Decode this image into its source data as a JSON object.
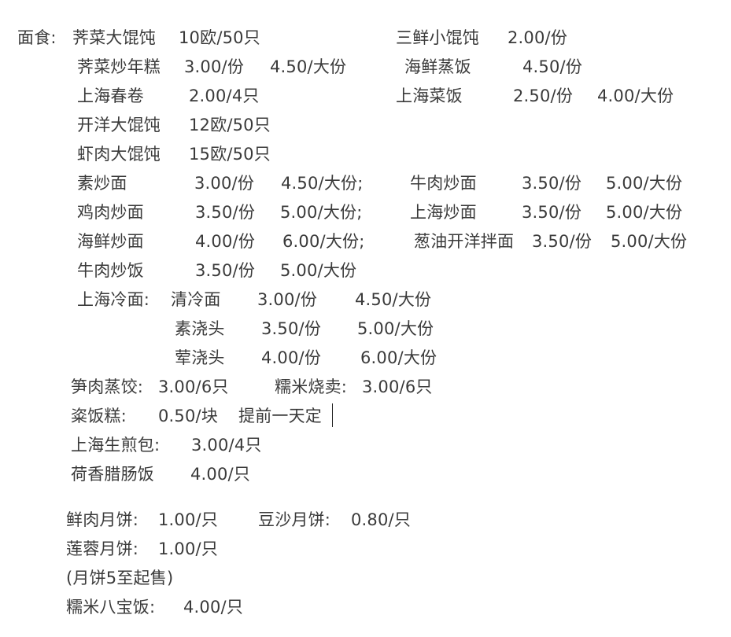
{
  "rows": {
    "r1": {
      "label": "面食:",
      "item_a": "荠菜大馄饨",
      "price_a": "10欧/50只",
      "item_b": "三鲜小馄饨",
      "price_b": "2.00/份"
    },
    "r2": {
      "item_a": "荠菜炒年糕",
      "price_a": "3.00/份",
      "price_a2": "4.50/大份",
      "item_b": "海鲜蒸饭",
      "price_b": "4.50/份"
    },
    "r3": {
      "item_a": "上海春卷",
      "price_a": "2.00/4只",
      "item_b": "上海菜饭",
      "price_b": "2.50/份",
      "price_b2": "4.00/大份"
    },
    "r4": {
      "item_a": "开洋大馄饨",
      "price_a": "12欧/50只"
    },
    "r5": {
      "item_a": "虾肉大馄饨",
      "price_a": "15欧/50只"
    },
    "r6": {
      "item_a": "素炒面",
      "price_a": "3.00/份",
      "price_a2": "4.50/大份;",
      "item_b": "牛肉炒面",
      "price_b": "3.50/份",
      "price_b2": "5.00/大份"
    },
    "r7": {
      "item_a": "鸡肉炒面",
      "price_a": "3.50/份",
      "price_a2": "5.00/大份;",
      "item_b": "上海炒面",
      "price_b": "3.50/份",
      "price_b2": "5.00/大份"
    },
    "r8": {
      "item_a": "海鲜炒面",
      "price_a": "4.00/份",
      "price_a2": "6.00/大份;",
      "item_b": "葱油开洋拌面",
      "price_b": "3.50/份",
      "price_b2": "5.00/大份"
    },
    "r9": {
      "item_a": "牛肉炒饭",
      "price_a": "3.50/份",
      "price_a2": "5.00/大份"
    },
    "r10": {
      "label": "上海冷面:",
      "item_a": "清冷面",
      "price_a": "3.00/份",
      "price_a2": "4.50/大份"
    },
    "r11": {
      "item_a": "素浇头",
      "price_a": "3.50/份",
      "price_a2": "5.00/大份"
    },
    "r12": {
      "item_a": "荤浇头",
      "price_a": "4.00/份",
      "price_a2": "6.00/大份"
    },
    "r13": {
      "item_a": "笋肉蒸饺:",
      "price_a": "3.00/6只",
      "item_b": "糯米烧卖:",
      "price_b": "3.00/6只"
    },
    "r14": {
      "item_a": "粢饭糕:",
      "price_a": "0.50/块",
      "note": "提前一天定"
    },
    "r15": {
      "item_a": "上海生煎包:",
      "price_a": "3.00/4只"
    },
    "r16": {
      "item_a": "荷香腊肠饭",
      "price_a": "4.00/只"
    },
    "r17": {
      "item_a": "鲜肉月饼:",
      "price_a": "1.00/只",
      "item_b": "豆沙月饼:",
      "price_b": "0.80/只"
    },
    "r18": {
      "item_a": "莲蓉月饼:",
      "price_a": "1.00/只"
    },
    "r19": {
      "note": "(月饼5至起售)"
    },
    "r20": {
      "item_a": "糯米八宝饭:",
      "price_a": "4.00/只"
    }
  },
  "colors": {
    "text": "#3a3a3a",
    "background": "#ffffff"
  }
}
